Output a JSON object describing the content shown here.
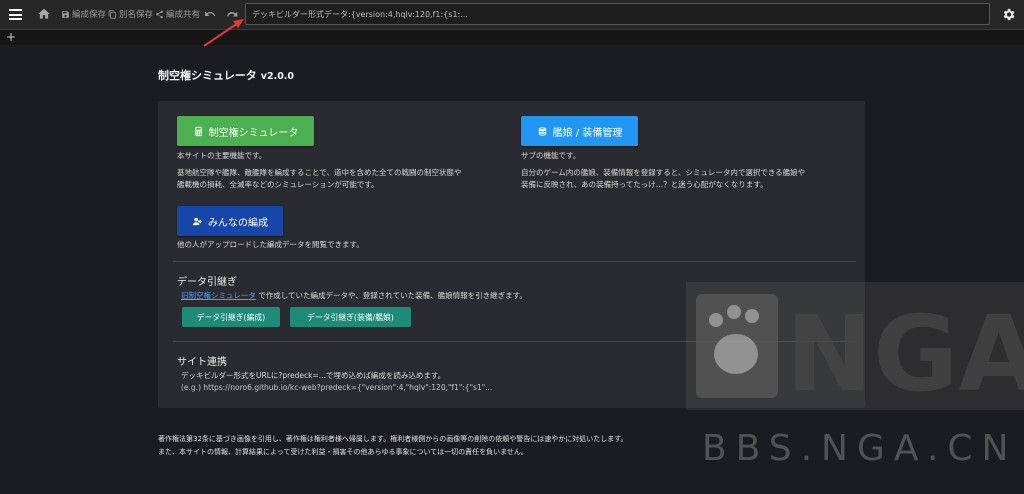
{
  "toolbar": {
    "save_label": "編成保存",
    "save_as_label": "別名保存",
    "share_label": "編成共有",
    "deck_input_value": "デッキビルダー形式データ:{version:4,hqlv:120,f1:{s1:..."
  },
  "tabs": {
    "add_label": "+"
  },
  "app": {
    "title": "制空権シミュレータ",
    "version": "v2.0.0"
  },
  "cards": {
    "sim": {
      "label": "制空権シミュレータ",
      "desc1": "本サイトの主要機能です。",
      "desc2": "基地航空隊や艦隊、敵艦隊を編成することで、道中を含めた全ての戦闘の制空状態や",
      "desc3": "艦載機の損耗、全滅率などのシミュレーションが可能です。"
    },
    "manage": {
      "label": "艦娘 / 装備管理",
      "desc1": "サブの機能です。",
      "desc2": "自分のゲーム内の艦娘、装備情報を登録すると、シミュレータ内で選択できる艦娘や",
      "desc3": "装備に反映され、あの装備持ってたっけ…？と迷う心配がなくなります。"
    },
    "share": {
      "label": "みんなの編成",
      "desc1": "他の人がアップロードした編成データを閲覧できます。"
    }
  },
  "transfer": {
    "title": "データ引継ぎ",
    "link": "旧制空権シミュレータ",
    "text": "で作成していた編成データや、登録されていた装備、艦娘情報を引き継ぎます。",
    "btn1": "データ引継ぎ(編成)",
    "btn2": "データ引継ぎ(装備/艦娘)"
  },
  "collab": {
    "title": "サイト連携",
    "line1": "デッキビルダー形式をURLに?predeck=...で埋め込めば編成を読み込めます。",
    "line2": "(e.g.) https://noro6.github.io/kc-web?predeck={\"version\":4,\"hqlv\":120,\"f1\":{\"s1\"..."
  },
  "footer": {
    "line1": "著作権法第32条に基づき画像を引用し、著作権は権利者様へ帰属します。権利者様側からの画像等の削除の依頼や警告には速やかに対処いたします。",
    "line2": "また、本サイトの情報、計算結果によって受けた利益・損害その他あらゆる事象については一切の責任を負いません。"
  },
  "watermark": {
    "logo_text": "NGA",
    "url_text": "BBS.NGA.CN"
  },
  "colors": {
    "green": "#4caf50",
    "blue": "#2196f3",
    "indigo": "#1546a8",
    "teal": "#1e8a7a",
    "link": "#4aa3ff",
    "annotation_arrow": "#e53935"
  },
  "icons": [
    "menu-icon",
    "home-icon",
    "save-icon",
    "copy-icon",
    "share-icon",
    "undo-icon",
    "redo-icon",
    "gear-icon",
    "calculator-icon",
    "database-icon",
    "account-group-icon"
  ]
}
